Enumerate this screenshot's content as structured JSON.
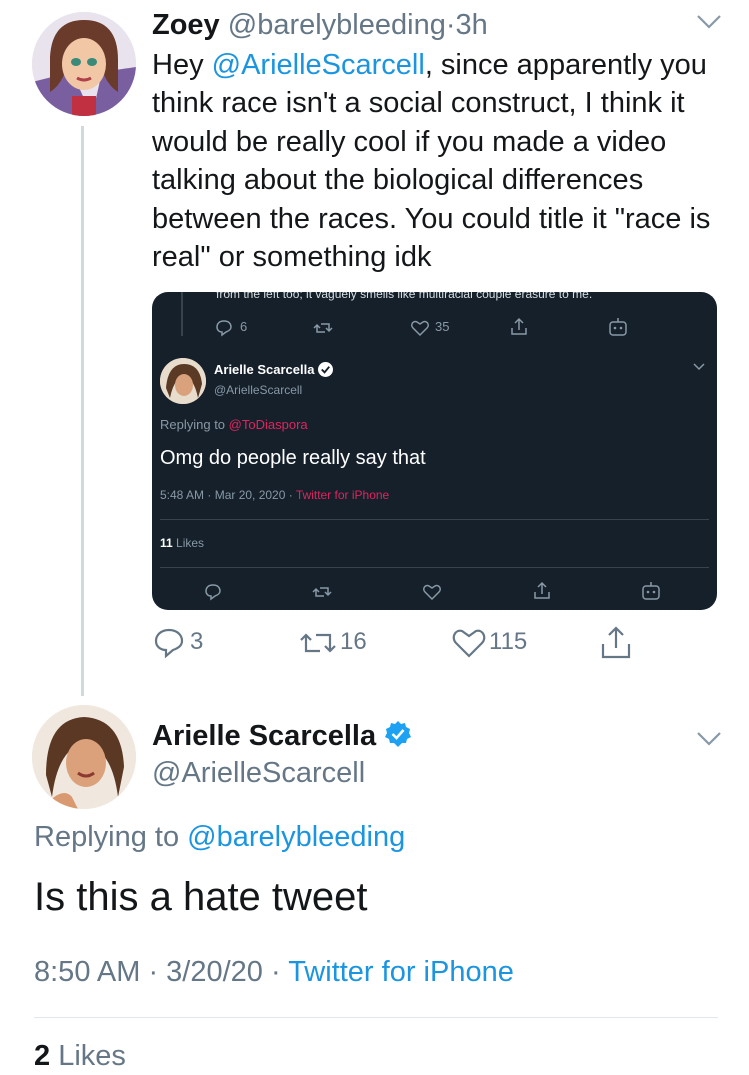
{
  "tweet": {
    "author_name": "Zoey",
    "author_handle": "@barelybleeding",
    "time": "3h",
    "text_mention": "@ArielleScarcell",
    "text_before": "Hey ",
    "text_after": ", since apparently you think race isn't a social construct, I think it would be really cool if you made a video talking about the biological differences between the races. You could title it \"race is real\" or something idk",
    "replies": "3",
    "retweets": "16",
    "likes": "115"
  },
  "embedded": {
    "top_text": "from the left too; it vaguely smells like multiracial couple erasure to me.",
    "top_replies": "6",
    "top_likes": "35",
    "author_name": "Arielle Scarcella",
    "author_handle": "@ArielleScarcell",
    "replying_label": "Replying to",
    "replying_handle": "@ToDiaspora",
    "text": "Omg do people really say that",
    "time": "5:48 AM · Mar 20, 2020 · ",
    "client": "Twitter for iPhone",
    "likes_count": "11",
    "likes_label": "Likes",
    "background": "#15202b"
  },
  "reply": {
    "author_name": "Arielle Scarcella",
    "author_handle": "@ArielleScarcell",
    "replying_label": "Replying to",
    "replying_handle": "@barelybleeding",
    "text": "Is this a hate tweet",
    "time": "8:50 AM · 3/20/20 · ",
    "client": "Twitter for iPhone",
    "likes_count": "2",
    "likes_label": "Likes"
  },
  "colors": {
    "link": "#1b95e0",
    "muted": "#657786",
    "verified": "#1da1f2"
  },
  "icons": [
    "chevron-down-icon",
    "reply-icon",
    "retweet-icon",
    "like-icon",
    "share-icon",
    "verified-icon",
    "bot-icon"
  ]
}
